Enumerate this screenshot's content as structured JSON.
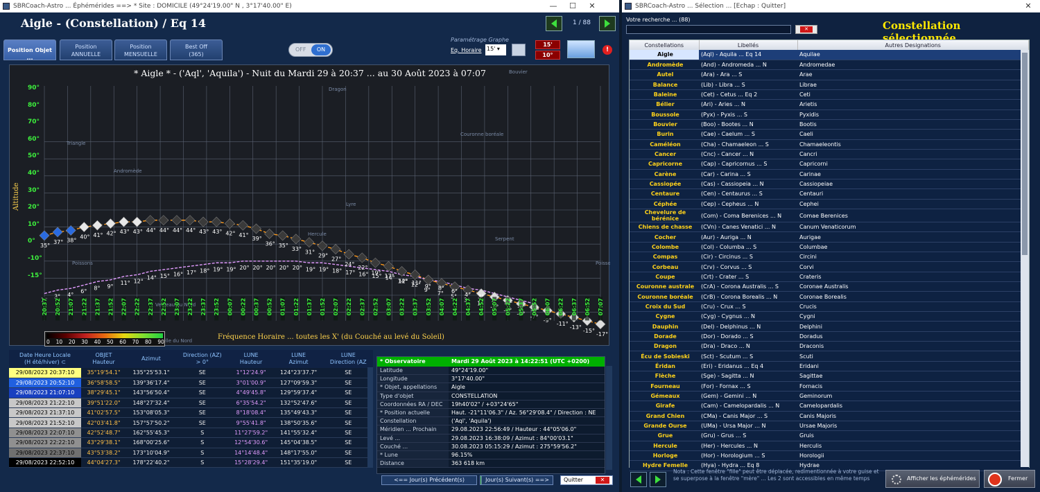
{
  "w1": {
    "title": "SBRCoach-Astro ... Éphémérides ==> * Site : DOMICILE (49°24'19.00\" N , 3°17'40.00\" E)",
    "heading": "Aigle - (Constellation) / Eq 14",
    "page": "1 / 88",
    "tabs": [
      "Position Objet ...",
      "Position\nANNUELLE",
      "Position\nMENSUELLE",
      "Best Off\n(365)"
    ],
    "toggle_off": "OFF",
    "toggle_on": "ON",
    "param_label": "Paramétrage Graphe",
    "eq_label": "Eq. Horaire",
    "eq_value": "15'",
    "red1": "15'",
    "red2": "10°",
    "plot_title": "* Aigle * - ('Aql', 'Aquila') - Nuit du Mardi 29 à 20:37 ... au 30 Août 2023 à 07:07",
    "ylabel": "Altitude",
    "footer": "Fréquence Horaire ... toutes les X' (du Couché au levé du Soleil)",
    "yticks": [
      "90°",
      "80°",
      "70°",
      "60°",
      "50°",
      "40°",
      "30°",
      "20°",
      "10°",
      "0°",
      "-10°",
      "-15°"
    ],
    "scale_labels": [
      "0",
      "10",
      "20",
      "30",
      "40",
      "50",
      "60",
      "70",
      "80",
      "90"
    ],
    "constellations": [
      "Dragon",
      "Bouvier",
      "Couronne boréale",
      "Triangle",
      "Andromède",
      "Lyre",
      "Hercule",
      "Serpent",
      "Poissons",
      "Poisson",
      "Verseau du Nord",
      "Aquarelle du Nord"
    ],
    "times": [
      "20:37",
      "20:52",
      "21:07",
      "21:22",
      "21:37",
      "21:52",
      "22:07",
      "22:22",
      "22:37",
      "22:52",
      "23:07",
      "23:22",
      "23:37",
      "23:52",
      "00:07",
      "00:22",
      "00:37",
      "00:52",
      "01:07",
      "01:22",
      "01:37",
      "01:52",
      "02:07",
      "02:22",
      "02:37",
      "02:52",
      "03:07",
      "03:22",
      "03:37",
      "03:52",
      "04:07",
      "04:22",
      "04:37",
      "04:52",
      "05:07",
      "05:22",
      "05:37",
      "05:52",
      "06:07",
      "06:22",
      "06:37",
      "06:52",
      "07:07"
    ],
    "obj_alt_labels": [
      "35°",
      "37°",
      "38°",
      "40°",
      "41°",
      "42°",
      "43°",
      "43°",
      "44°",
      "44°",
      "44°",
      "44°",
      "43°",
      "43°",
      "42°",
      "41°",
      "39°",
      "36°",
      "35°",
      "33°",
      "31°",
      "29°",
      "27°",
      "24°",
      "22°",
      "19°",
      "17°",
      "14°",
      "12°",
      "9°",
      "7°",
      "5°",
      "3°",
      "1°",
      "-1°",
      "-3°",
      "-5°",
      "-7°",
      "-9°",
      "-11°",
      "-13°",
      "-15°",
      "-17°"
    ],
    "moon_alt_labels": [
      "1°",
      "3°",
      "4°",
      "6°",
      "8°",
      "9°",
      "11°",
      "12°",
      "14°",
      "15°",
      "16°",
      "17°",
      "18°",
      "19°",
      "19°",
      "20°",
      "20°",
      "20°",
      "20°",
      "20°",
      "19°",
      "19°",
      "18°",
      "17°",
      "16°",
      "15°",
      "14°",
      "12°",
      "11°",
      "9°",
      "8°",
      "6°",
      "4°",
      "3°",
      "1°",
      "-1°",
      "-3°",
      "-5°"
    ],
    "table_head": [
      "Date Heure Locale\n(H été/hiver) ⊂",
      "OBJET\nHauteur",
      "Azimut",
      "Direction (AZ)\n> 0°",
      "LUNE\nHauteur",
      "LUNE\nAzimut",
      "LUNE\nDirection (AZ"
    ],
    "rows": [
      [
        "29/08/2023 20:37:10",
        "35°19'54.1\"",
        "135°25'53.1\"",
        "SE",
        "1°12'24.9\"",
        "124°23'37.7\"",
        "SE"
      ],
      [
        "29/08/2023 20:52:10",
        "36°58'58.5\"",
        "139°36'17.4\"",
        "SE",
        "3°01'00.9\"",
        "127°09'59.3\"",
        "SE"
      ],
      [
        "29/08/2023 21:07:10",
        "38°29'45.1\"",
        "143°56'50.4\"",
        "SE",
        "4°49'45.8\"",
        "129°59'37.4\"",
        "SE"
      ],
      [
        "29/08/2023 21:22:10",
        "39°51'22.0\"",
        "148°27'32.4\"",
        "SE",
        "6°35'54.2\"",
        "132°52'47.6\"",
        "SE"
      ],
      [
        "29/08/2023 21:37:10",
        "41°02'57.5\"",
        "153°08'05.3\"",
        "SE",
        "8°18'08.4\"",
        "135°49'43.3\"",
        "SE"
      ],
      [
        "29/08/2023 21:52:10",
        "42°03'41.8\"",
        "157°57'50.2\"",
        "SE",
        "9°55'41.8\"",
        "138°50'35.6\"",
        "SE"
      ],
      [
        "29/08/2023 22:07:10",
        "42°52'48.7\"",
        "162°55'45.3\"",
        "S",
        "11°27'59.2\"",
        "141°55'32.4\"",
        "SE"
      ],
      [
        "29/08/2023 22:22:10",
        "43°29'38.1\"",
        "168°00'25.6\"",
        "S",
        "12°54'30.6\"",
        "145°04'38.5\"",
        "SE"
      ],
      [
        "29/08/2023 22:37:10",
        "43°53'38.2\"",
        "173°10'04.9\"",
        "S",
        "14°14'48.4\"",
        "148°17'55.0\"",
        "SE"
      ],
      [
        "29/08/2023 22:52:10",
        "44°04'27.3\"",
        "178°22'40.2\"",
        "S",
        "15°28'29.4\"",
        "151°35'19.0\"",
        "SE"
      ]
    ],
    "row_colors": [
      "#ffff80",
      "#2060e0",
      "#1840c0",
      "#c8c8c8",
      "#c8c8c8",
      "#c8c8c8",
      "#909090",
      "#909090",
      "#707070",
      "#000000"
    ],
    "info_head": [
      "* Observatoire (calculs)",
      "Mardi 29 Août 2023 à 14:22:51   (UTC +0200)"
    ],
    "info": [
      [
        "Latitude",
        "49°24'19.00\""
      ],
      [
        "Longitude",
        "3°17'40.00\""
      ],
      [
        "* Objet, appellations",
        "Aigle"
      ],
      [
        "Type d'objet",
        "CONSTELLATION"
      ],
      [
        "Coordonnées RA / DEC",
        "19h40'02\" / +03°24'65\""
      ],
      [
        "* Position actuelle",
        "Haut. -21°11'06.3\" / Az. 56°29'08.4\" / Direction : NE"
      ],
      [
        "Constellation",
        "('Aql', 'Aquila')"
      ],
      [
        "Méridien ... Prochain",
        "29.08.2023 22:56:49 / Hauteur : 44°05'06.0\""
      ],
      [
        "Levé ...",
        "29.08.2023 16:38:09 / Azimut : 84°00'03.1\""
      ],
      [
        "Couché ...",
        "30.08.2023 05:15:29 / Azimut : 275°59'56.2\""
      ],
      [
        "* Lune",
        "96.15%"
      ],
      [
        "Distance",
        "363 618 km"
      ]
    ],
    "prev_btn": "<== Jour(s) Précédent(s)",
    "day_count": "1",
    "next_btn": "Jour(s) Suivant(s) ==>",
    "quit_btn": "Quitter"
  },
  "w2": {
    "title": "SBRCoach-Astro ... Sélection ... [Echap : Quitter]",
    "search_label": "Votre recherche ... (88)",
    "heading": "Constellation sélectionnée...",
    "columns": [
      "Constellations",
      "Libellés",
      "Autres Designations"
    ],
    "rows": [
      [
        "Aigle",
        "(Aql) - Aquila ... Eq 14",
        "Aquilae"
      ],
      [
        "Andromède",
        "(And) - Andromeda ... N",
        "Andromedae"
      ],
      [
        "Autel",
        "(Ara) - Ara ... S",
        "Arae"
      ],
      [
        "Balance",
        "(Lib) - Libra ... S",
        "Librae"
      ],
      [
        "Baleine",
        "(Cet) - Cetus ... Eq 2",
        "Ceti"
      ],
      [
        "Bélier",
        "(Ari) - Aries ... N",
        "Arietis"
      ],
      [
        "Boussole",
        "(Pyx) - Pyxis ... S",
        "Pyxidis"
      ],
      [
        "Bouvier",
        "(Boo) - Bootes ... N",
        "Bootis"
      ],
      [
        "Burin",
        "(Cae) - Caelum ... S",
        "Caeli"
      ],
      [
        "Caméléon",
        "(Cha) - Chamaeleon ... S",
        "Chamaeleontis"
      ],
      [
        "Cancer",
        "(Cnc) - Cancer ... N",
        "Cancri"
      ],
      [
        "Capricorne",
        "(Cap) - Capricornus ... S",
        "Capricorni"
      ],
      [
        "Carène",
        "(Car) - Carina ... S",
        "Carinae"
      ],
      [
        "Cassiopée",
        "(Cas) - Cassiopeia ... N",
        "Cassiopeiae"
      ],
      [
        "Centaure",
        "(Cen) - Centaurus ... S",
        "Centauri"
      ],
      [
        "Céphée",
        "(Cep) - Cepheus ... N",
        "Cephei"
      ],
      [
        "Chevelure de bérénice",
        "(Com) - Coma Berenices ... N",
        "Comae Berenices"
      ],
      [
        "Chiens de chasse",
        "(CVn) - Canes Venatici ... N",
        "Canum Venaticorum"
      ],
      [
        "Cocher",
        "(Aur) - Auriga ... N",
        "Aurigae"
      ],
      [
        "Colombe",
        "(Col) - Columba ... S",
        "Columbae"
      ],
      [
        "Compas",
        "(Cir) - Circinus ... S",
        "Circini"
      ],
      [
        "Corbeau",
        "(Crv) - Corvus ... S",
        "Corvi"
      ],
      [
        "Coupe",
        "(Crt) - Crater ... S",
        "Crateris"
      ],
      [
        "Couronne australe",
        "(CrA) - Corona Australis ... S",
        "Coronae Australis"
      ],
      [
        "Couronne boréale",
        "(CrB) - Corona Borealis ... N",
        "Coronae Borealis"
      ],
      [
        "Croix du Sud",
        "(Cru) - Crux ... S",
        "Crucis"
      ],
      [
        "Cygne",
        "(Cyg) - Cygnus ... N",
        "Cygni"
      ],
      [
        "Dauphin",
        "(Del) - Delphinus ... N",
        "Delphini"
      ],
      [
        "Dorade",
        "(Dor) - Dorado ... S",
        "Doradus"
      ],
      [
        "Dragon",
        "(Dra) - Draco ... N",
        "Draconis"
      ],
      [
        "Écu de Sobieski",
        "(Sct) - Scutum ... S",
        "Scuti"
      ],
      [
        "Éridan",
        "(Eri) - Eridanus ... Eq 4",
        "Eridani"
      ],
      [
        "Flèche",
        "(Sge) - Sagitta ... N",
        "Sagittae"
      ],
      [
        "Fourneau",
        "(For) - Fornax ... S",
        "Fornacis"
      ],
      [
        "Gémeaux",
        "(Gem) - Gemini ... N",
        "Geminorum"
      ],
      [
        "Girafe",
        "(Cam) - Camelopardalis ... N",
        "Camelopardalis"
      ],
      [
        "Grand Chien",
        "(CMa) - Canis Major ... S",
        "Canis Majoris"
      ],
      [
        "Grande Ourse",
        "(UMa) - Ursa Major ... N",
        "Ursae Majoris"
      ],
      [
        "Grue",
        "(Gru) - Grus ... S",
        "Gruis"
      ],
      [
        "Hercule",
        "(Her) - Hercules ... N",
        "Herculis"
      ],
      [
        "Horloge",
        "(Hor) - Horologium ... S",
        "Horologii"
      ],
      [
        "Hydre Femelle",
        "(Hya) - Hydra ... Eq 8",
        "Hydrae"
      ]
    ],
    "note": "Nota : Cette fenêtre \"fille\" peut être déplacée, redimentionnée à votre guise et se superpose à la fenêtre \"mère\" ... Les 2 sont accessibles en même temps",
    "show_btn": "Afficher les éphémérides",
    "close_btn": "Fermer"
  }
}
